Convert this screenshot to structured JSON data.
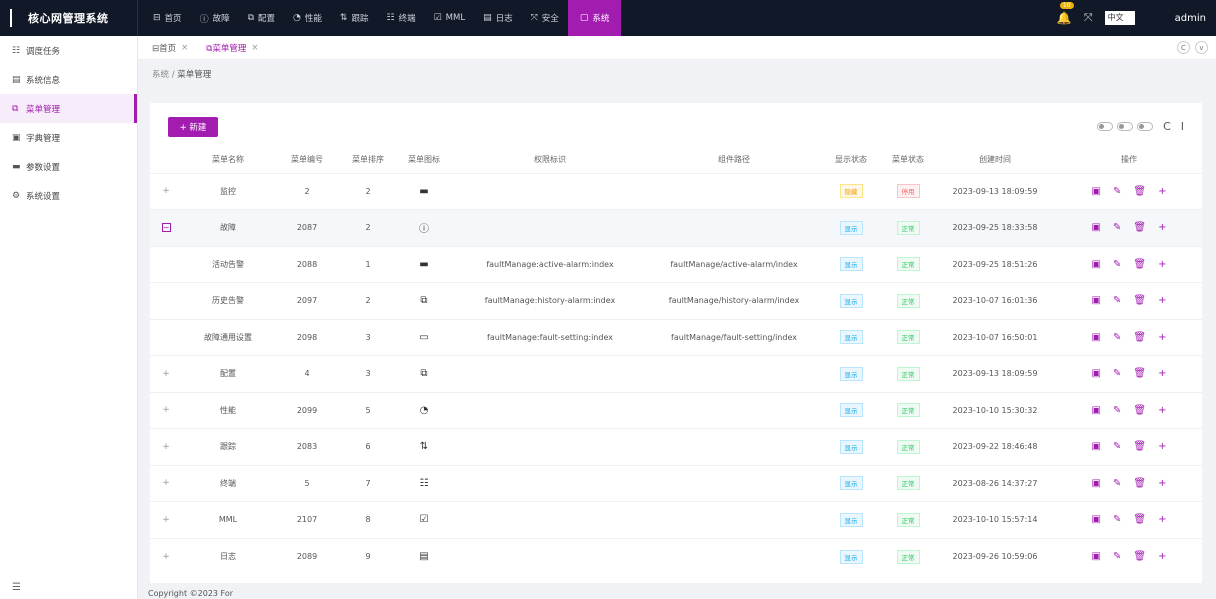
{
  "app": {
    "title": "核心网管理系统",
    "user": "admin",
    "lang": "中文",
    "bell_count": "10"
  },
  "topnav": [
    {
      "icon": "⊟",
      "label": "首页"
    },
    {
      "icon": "ⓘ",
      "label": "故障"
    },
    {
      "icon": "⧉",
      "label": "配置"
    },
    {
      "icon": "◔",
      "label": "性能"
    },
    {
      "icon": "⇅",
      "label": "跟踪"
    },
    {
      "icon": "☷",
      "label": "终端"
    },
    {
      "icon": "☑",
      "label": "MML"
    },
    {
      "icon": "▤",
      "label": "日志"
    },
    {
      "icon": "⤧",
      "label": "安全"
    },
    {
      "icon": "▢",
      "label": "系统"
    }
  ],
  "sidebar": [
    {
      "icon": "☷",
      "label": "调度任务"
    },
    {
      "icon": "▤",
      "label": "系统信息"
    },
    {
      "icon": "⧉",
      "label": "菜单管理"
    },
    {
      "icon": "▣",
      "label": "字典管理"
    },
    {
      "icon": "▬",
      "label": "参数设置"
    },
    {
      "icon": "⚙",
      "label": "系统设置"
    }
  ],
  "tabs": [
    {
      "label": "⊟首页"
    },
    {
      "label": "⧉菜单管理"
    }
  ],
  "breadcrumb": {
    "parent": "系统",
    "sep": "/",
    "current": "菜单管理"
  },
  "toolbar": {
    "new_label": "+ 新建",
    "refresh_icon": "C",
    "density_icon": "I"
  },
  "table": {
    "columns": [
      "菜单名称",
      "菜单编号",
      "菜单排序",
      "菜单图标",
      "权限标识",
      "组件路径",
      "显示状态",
      "菜单状态",
      "创建时间",
      "操作"
    ],
    "rows": [
      {
        "exp": "+",
        "name": "监控",
        "id": "2",
        "order": "2",
        "icon": "▬",
        "perm": "",
        "path": "",
        "show": "隐藏",
        "status": "停用",
        "time": "2023-09-13 18:09:59"
      },
      {
        "exp": "−",
        "name": "故障",
        "id": "2087",
        "order": "2",
        "icon": "ⓘ",
        "perm": "",
        "path": "",
        "show": "显示",
        "status": "正常",
        "time": "2023-09-25 18:33:58"
      },
      {
        "exp": "",
        "name": "活动告警",
        "id": "2088",
        "order": "1",
        "icon": "▬",
        "perm": "faultManage:active-alarm:index",
        "path": "faultManage/active-alarm/index",
        "show": "显示",
        "status": "正常",
        "time": "2023-09-25 18:51:26"
      },
      {
        "exp": "",
        "name": "历史告警",
        "id": "2097",
        "order": "2",
        "icon": "⧉",
        "perm": "faultManage:history-alarm:index",
        "path": "faultManage/history-alarm/index",
        "show": "显示",
        "status": "正常",
        "time": "2023-10-07 16:01:36"
      },
      {
        "exp": "",
        "name": "故障通用设置",
        "id": "2098",
        "order": "3",
        "icon": "▭",
        "perm": "faultManage:fault-setting:index",
        "path": "faultManage/fault-setting/index",
        "show": "显示",
        "status": "正常",
        "time": "2023-10-07 16:50:01"
      },
      {
        "exp": "+",
        "name": "配置",
        "id": "4",
        "order": "3",
        "icon": "⧉",
        "perm": "",
        "path": "",
        "show": "显示",
        "status": "正常",
        "time": "2023-09-13 18:09:59"
      },
      {
        "exp": "+",
        "name": "性能",
        "id": "2099",
        "order": "5",
        "icon": "◔",
        "perm": "",
        "path": "",
        "show": "显示",
        "status": "正常",
        "time": "2023-10-10 15:30:32"
      },
      {
        "exp": "+",
        "name": "跟踪",
        "id": "2083",
        "order": "6",
        "icon": "⇅",
        "perm": "",
        "path": "",
        "show": "显示",
        "status": "正常",
        "time": "2023-09-22 18:46:48"
      },
      {
        "exp": "+",
        "name": "终端",
        "id": "5",
        "order": "7",
        "icon": "☷",
        "perm": "",
        "path": "",
        "show": "显示",
        "status": "正常",
        "time": "2023-08-26 14:37:27"
      },
      {
        "exp": "+",
        "name": "MML",
        "id": "2107",
        "order": "8",
        "icon": "☑",
        "perm": "",
        "path": "",
        "show": "显示",
        "status": "正常",
        "time": "2023-10-10 15:57:14"
      },
      {
        "exp": "+",
        "name": "日志",
        "id": "2089",
        "order": "9",
        "icon": "▤",
        "perm": "",
        "path": "",
        "show": "显示",
        "status": "正常",
        "time": "2023-09-26 10:59:06"
      }
    ]
  },
  "footer": {
    "copyright": "Copyright ©2023 For"
  }
}
